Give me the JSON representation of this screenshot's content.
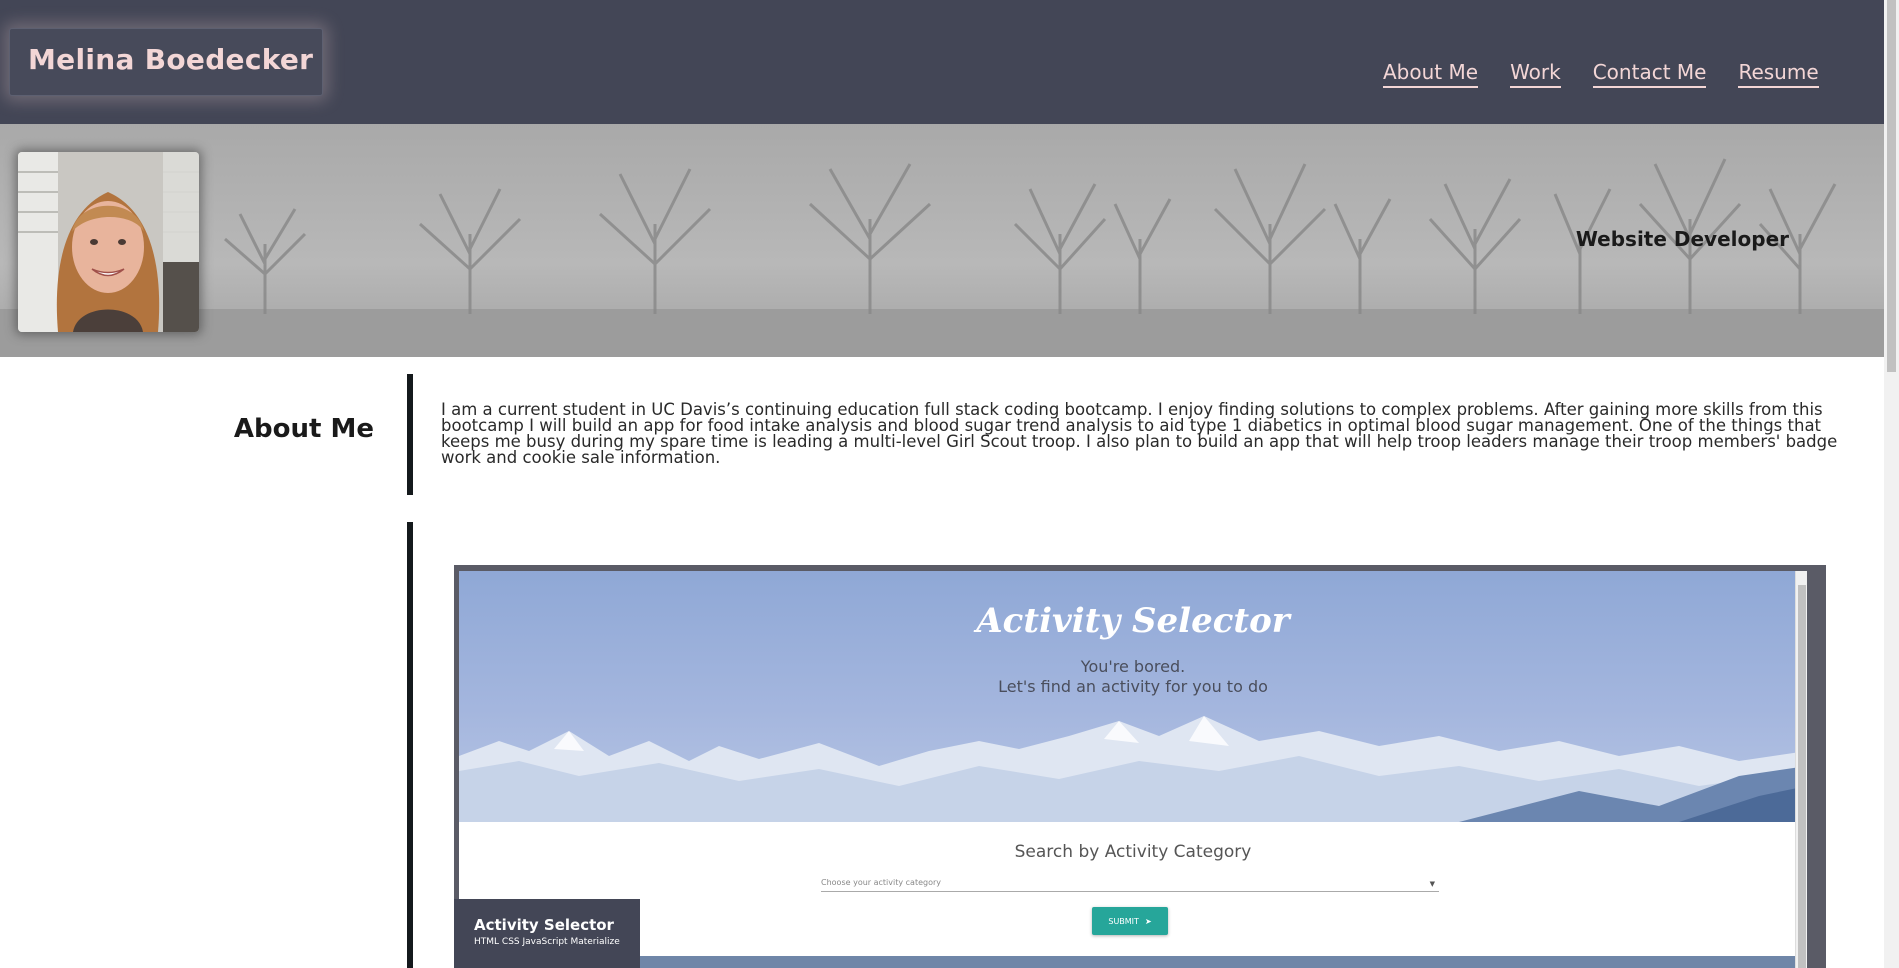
{
  "header": {
    "site_title": "Melina Boedecker",
    "nav": [
      {
        "label": "About Me"
      },
      {
        "label": "Work"
      },
      {
        "label": "Contact Me"
      },
      {
        "label": "Resume"
      }
    ]
  },
  "hero": {
    "tagline": "Website Developer"
  },
  "about": {
    "heading": "About Me",
    "body": "I am a current student in UC Davis’s continuing education full stack coding bootcamp. I enjoy finding solutions to complex problems. After gaining more skills from this bootcamp I will build an app for food intake analysis and blood sugar trend analysis to aid type 1 diabetics in optimal blood sugar management. One of the things that keeps me busy during my spare time is leading a multi-level Girl Scout troop. I also plan to build an app that will help troop leaders manage their troop members' badge work and cookie sale information."
  },
  "work": {
    "projects": [
      {
        "name": "Activity Selector",
        "tech": "HTML CSS JavaScript Materialize",
        "screenshot": {
          "title": "Activity Selector",
          "subtitle_line1": "You're bored.",
          "subtitle_line2": "Let's find an activity for you to do",
          "search_heading": "Search by Activity Category",
          "select_placeholder": "Choose your activity category",
          "submit_label": "SUBMIT"
        }
      }
    ]
  },
  "colors": {
    "header_bg": "#434656",
    "accent_text": "#f3d6d6",
    "divider": "#14191c",
    "submit_button": "#26a69a"
  }
}
